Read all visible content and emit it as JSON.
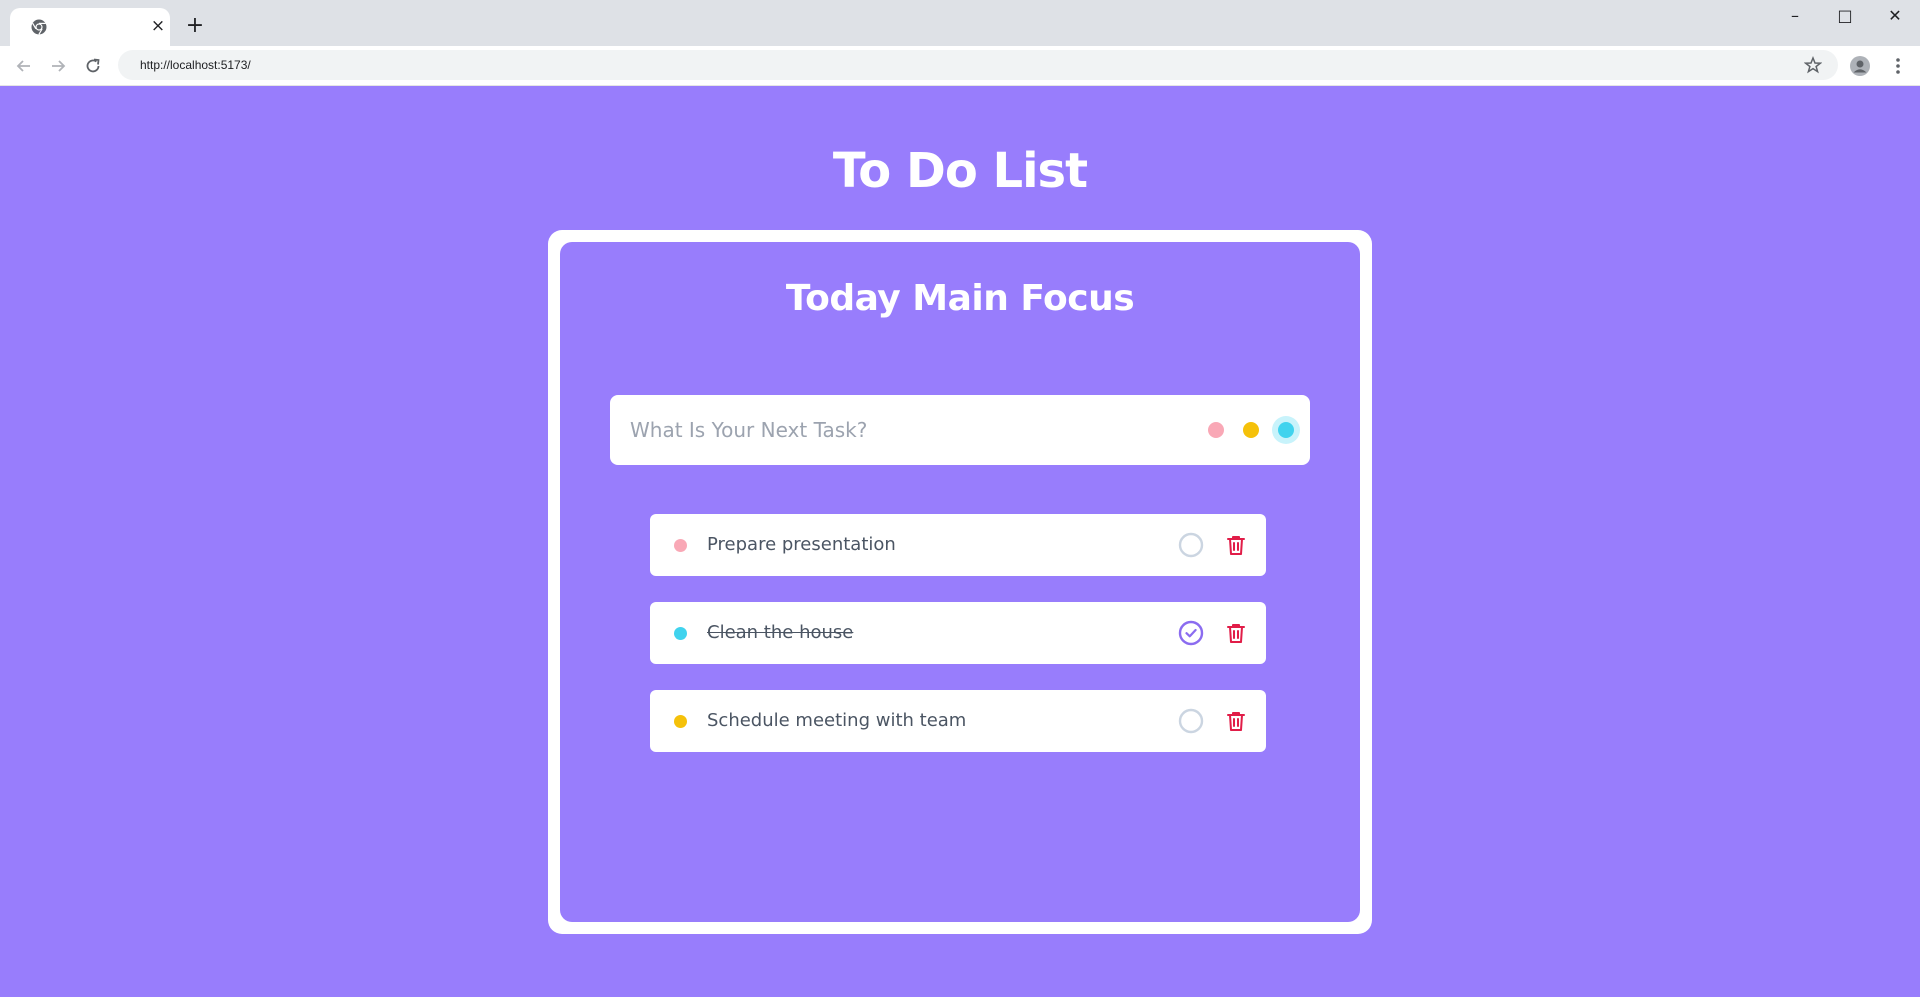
{
  "browser": {
    "tab_title": "",
    "tab_close": "×",
    "new_tab": "+",
    "url": "http://localhost:5173/",
    "window_controls": {
      "minimize": "–",
      "maximize": "□",
      "close": "✕"
    }
  },
  "page": {
    "title": "To Do List",
    "card_title": "Today Main Focus",
    "input": {
      "placeholder": "What Is Your Next Task?",
      "value": ""
    },
    "priorities": [
      {
        "name": "pink",
        "color": "#f9a8b6",
        "selected": false
      },
      {
        "name": "yellow",
        "color": "#f5c10a",
        "selected": false
      },
      {
        "name": "cyan",
        "color": "#40d3ee",
        "selected": true
      }
    ],
    "tasks": [
      {
        "text": "Prepare presentation",
        "color": "#f9a8b6",
        "completed": false
      },
      {
        "text": "Clean the house",
        "color": "#40d3ee",
        "completed": true
      },
      {
        "text": "Schedule meeting with team",
        "color": "#f5c10a",
        "completed": false
      }
    ]
  },
  "colors": {
    "background": "#987dfc",
    "accent": "#8b6cf0",
    "delete": "#e11d48",
    "unchecked": "#cbd5e1"
  }
}
